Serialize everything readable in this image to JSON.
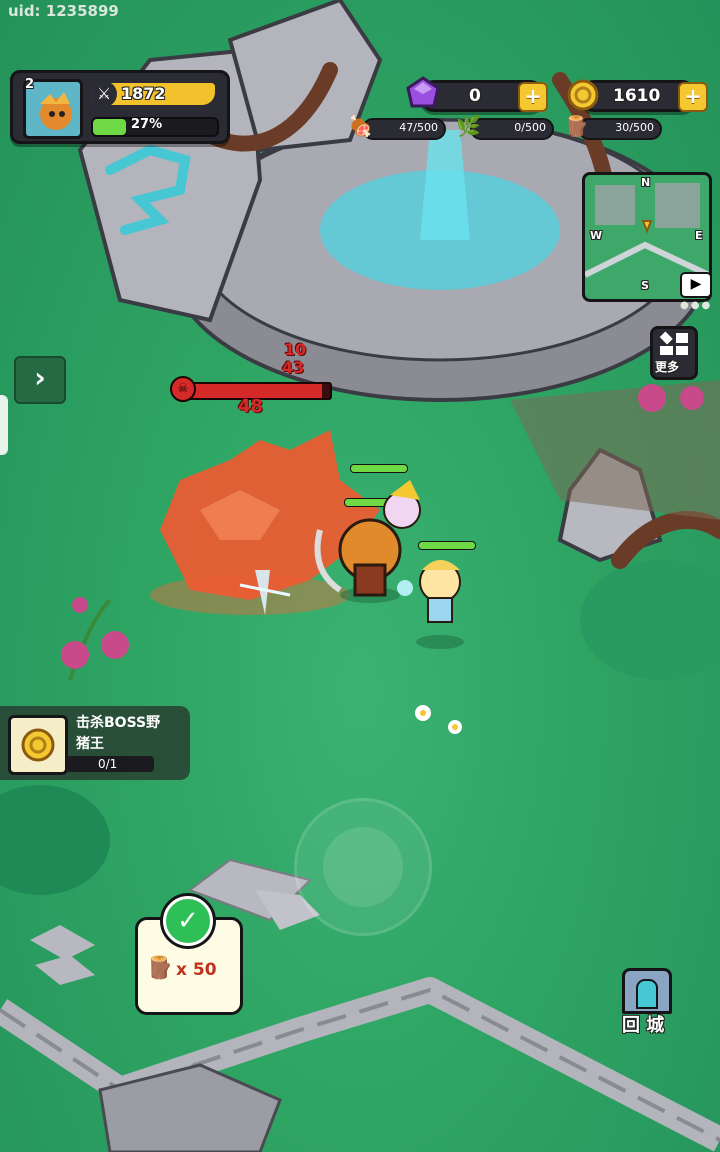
{
  "uid": "uid: 1235899",
  "player": {
    "level": "2",
    "power": "1872",
    "exp_label": "27%",
    "exp_fraction": 0.27
  },
  "resources": {
    "gems": "0",
    "gold": "1610",
    "meat": "47/500",
    "herb": "0/500",
    "wood": "30/500"
  },
  "minimap": {
    "north": "N",
    "south": "S",
    "east": "E",
    "west": "W"
  },
  "more_label": "更多",
  "boss": {
    "damage_numbers": [
      "10",
      "43",
      "48"
    ],
    "hp_fraction": 0.95
  },
  "quest": {
    "title_line1": "击杀BOSS野",
    "title_line2": "猪王",
    "progress": "0/1"
  },
  "reward": {
    "amount": "x 50"
  },
  "return_town_label": "回 城",
  "colors": {
    "accent_gold": "#f4c830",
    "exp_green": "#6fd845",
    "boss_red": "#d62a2a",
    "ground_green": "#2ea463"
  }
}
